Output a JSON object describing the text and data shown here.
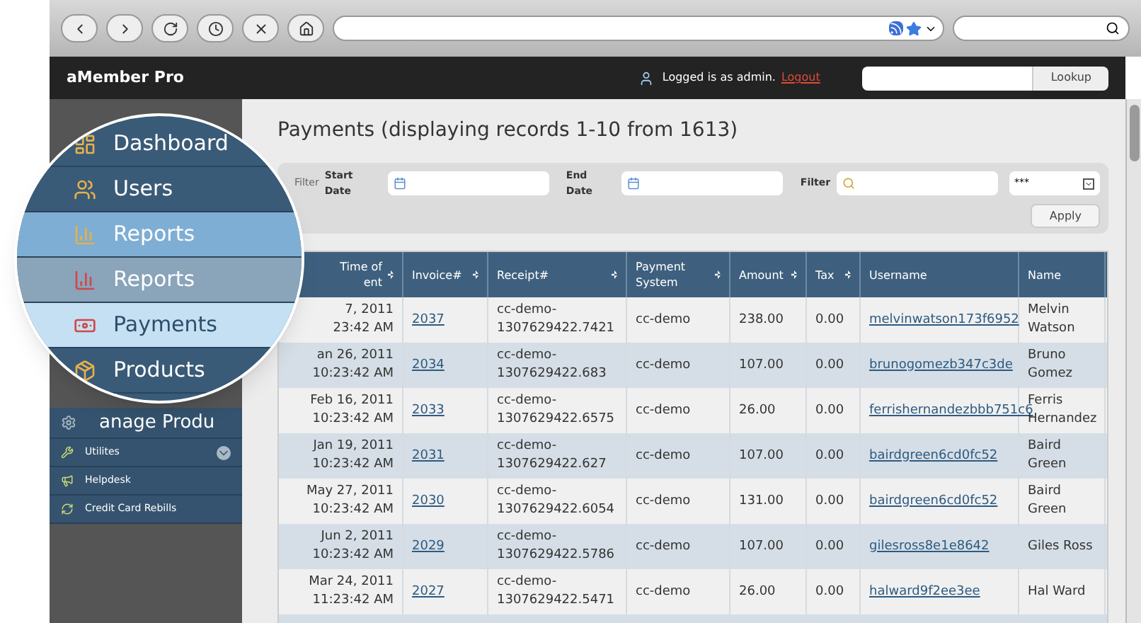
{
  "header": {
    "brand": "aMember Pro",
    "user_text": "Logged is as admin.",
    "logout": "Logout",
    "lookup_button": "Lookup"
  },
  "magnifier": {
    "items": [
      {
        "label": "Dashboard",
        "kind": "top",
        "selected": false
      },
      {
        "label": "Users",
        "kind": "top",
        "selected": false
      },
      {
        "label": "Reports",
        "kind": "top",
        "selected": true
      },
      {
        "label": "Reports",
        "kind": "sub",
        "selected": false
      },
      {
        "label": "Payments",
        "kind": "sub",
        "selected": true
      },
      {
        "label": "Products",
        "kind": "top",
        "selected": false
      }
    ]
  },
  "sidebar": {
    "items": [
      {
        "label": "anage Produ",
        "kind": "large",
        "expandable": false
      },
      {
        "label": "Utilites",
        "kind": "small",
        "expandable": true
      },
      {
        "label": "Helpdesk",
        "kind": "small",
        "expandable": false
      },
      {
        "label": "Credit Card Rebills",
        "kind": "small",
        "expandable": false
      }
    ]
  },
  "main": {
    "title": "Payments (displaying records 1-10 from 1613)",
    "filter": {
      "prefix": "Filter",
      "start_label": "Start Date",
      "end_label": "End Date",
      "filter_label": "Filter",
      "select_value": "***",
      "apply": "Apply"
    },
    "table": {
      "columns": [
        {
          "label": "Time of\nent",
          "sortable": true
        },
        {
          "label": "Invoice#",
          "sortable": true
        },
        {
          "label": "Receipt#",
          "sortable": true
        },
        {
          "label": "Payment System",
          "sortable": true
        },
        {
          "label": "Amount",
          "sortable": true
        },
        {
          "label": "Tax",
          "sortable": true
        },
        {
          "label": "Username",
          "sortable": false
        },
        {
          "label": "Name",
          "sortable": false
        }
      ],
      "rows": [
        [
          "7, 2011\n23:42 AM",
          "2037",
          "cc-demo- 1307629422.7421",
          "cc-demo",
          "238.00",
          "0.00",
          "melvinwatson173f6952",
          "Melvin Watson"
        ],
        [
          "an 26, 2011\n10:23:42 AM",
          "2034",
          "cc-demo- 1307629422.683",
          "cc-demo",
          "107.00",
          "0.00",
          "brunogomezb347c3de",
          "Bruno Gomez"
        ],
        [
          "Feb 16, 2011 10:23:42 AM",
          "2033",
          "cc-demo- 1307629422.6575",
          "cc-demo",
          "26.00",
          "0.00",
          "ferrishernandezbbb751c6",
          "Ferris Hernandez"
        ],
        [
          "Jan 19, 2011 10:23:42 AM",
          "2031",
          "cc-demo- 1307629422.627",
          "cc-demo",
          "107.00",
          "0.00",
          "bairdgreen6cd0fc52",
          "Baird Green"
        ],
        [
          "May 27, 2011 10:23:42 AM",
          "2030",
          "cc-demo- 1307629422.6054",
          "cc-demo",
          "131.00",
          "0.00",
          "bairdgreen6cd0fc52",
          "Baird Green"
        ],
        [
          "Jun 2, 2011 10:23:42 AM",
          "2029",
          "cc-demo- 1307629422.5786",
          "cc-demo",
          "107.00",
          "0.00",
          "gilesross8e1e8642",
          "Giles Ross"
        ],
        [
          "Mar 24, 2011 11:23:42 AM",
          "2027",
          "cc-demo- 1307629422.5471",
          "cc-demo",
          "26.00",
          "0.00",
          "halward9f2ee3ee",
          "Hal Ward"
        ]
      ]
    }
  }
}
